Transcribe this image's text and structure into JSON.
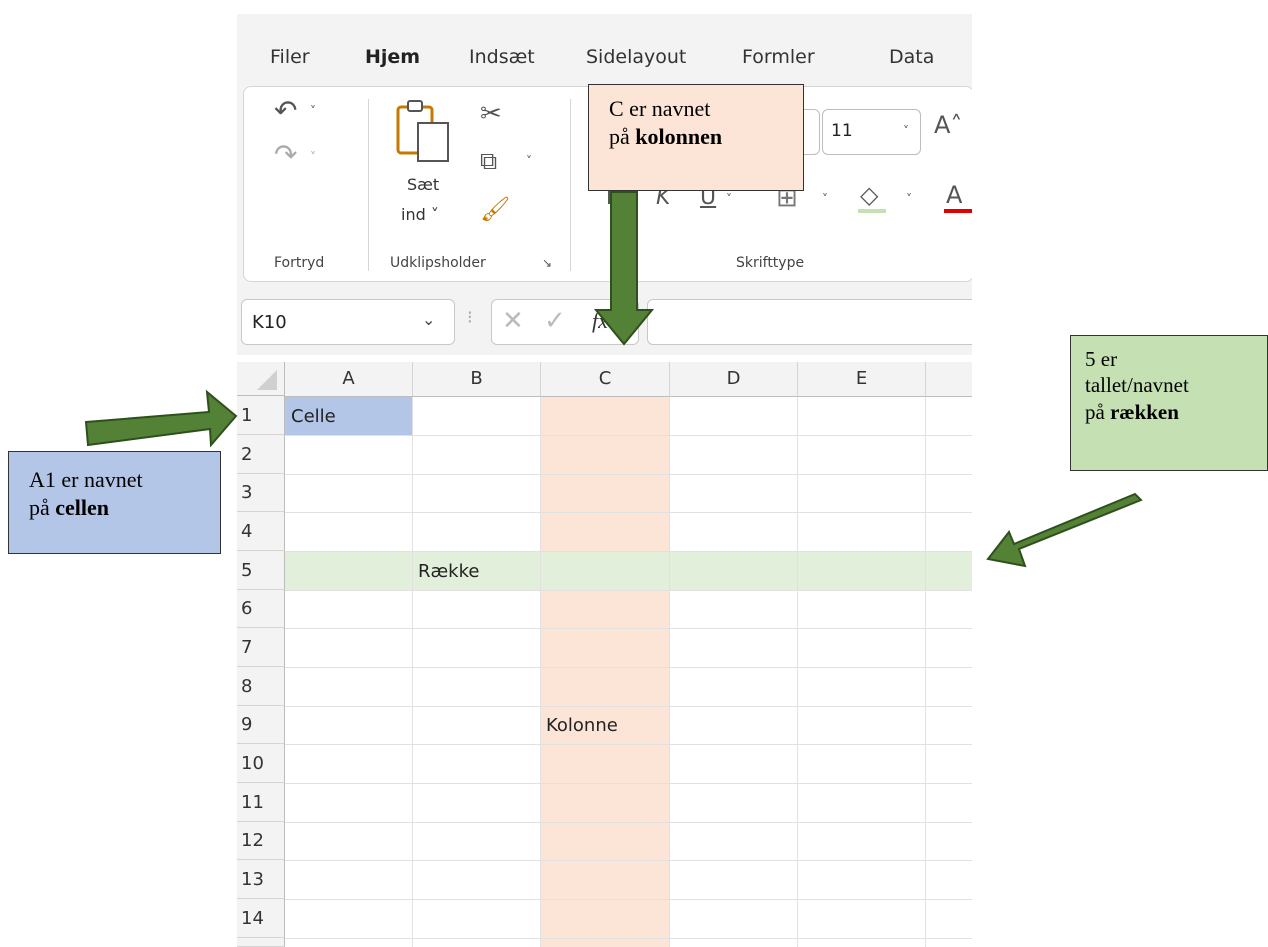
{
  "ribbon_tabs": [
    "Filer",
    "Hjem",
    "Indsæt",
    "Sidelayout",
    "Formler",
    "Data"
  ],
  "ribbon": {
    "paste_label_1": "Sæt",
    "paste_label_2": "ind ˅",
    "group_undo": "Fortryd",
    "group_clipboard": "Udklipsholder",
    "group_font": "Skrifttype",
    "font_size": "11",
    "grow_font": "A˄"
  },
  "formula_bar": {
    "name_box": "K10",
    "fx": "fx",
    "formula_value": ""
  },
  "grid": {
    "columns": [
      "A",
      "B",
      "C",
      "D",
      "E"
    ],
    "rows": [
      "1",
      "2",
      "3",
      "4",
      "5",
      "6",
      "7",
      "8",
      "9",
      "10",
      "11",
      "12",
      "13",
      "14"
    ],
    "cell_a1": "Celle",
    "cell_b5": "Række",
    "cell_c9": "Kolonne"
  },
  "annotations": {
    "column_note_1": "C er navnet",
    "column_note_2": "på ",
    "column_note_bold": "kolonnen",
    "row_note_1": "5 er",
    "row_note_2": "tallet/navnet",
    "row_note_3": "på ",
    "row_note_bold": "rækken",
    "cell_note_1": "A1 er navnet",
    "cell_note_2": "på ",
    "cell_note_bold": "cellen"
  },
  "colors": {
    "column_highlight": "#fce4d6",
    "row_highlight": "#e2efda",
    "cell_highlight": "#b4c6e7",
    "arrow": "#538135",
    "column_callout_bg": "#fce4d6",
    "row_callout_bg": "#c5e0b3",
    "cell_callout_bg": "#b4c6e7",
    "accent_green": "#107c41"
  }
}
